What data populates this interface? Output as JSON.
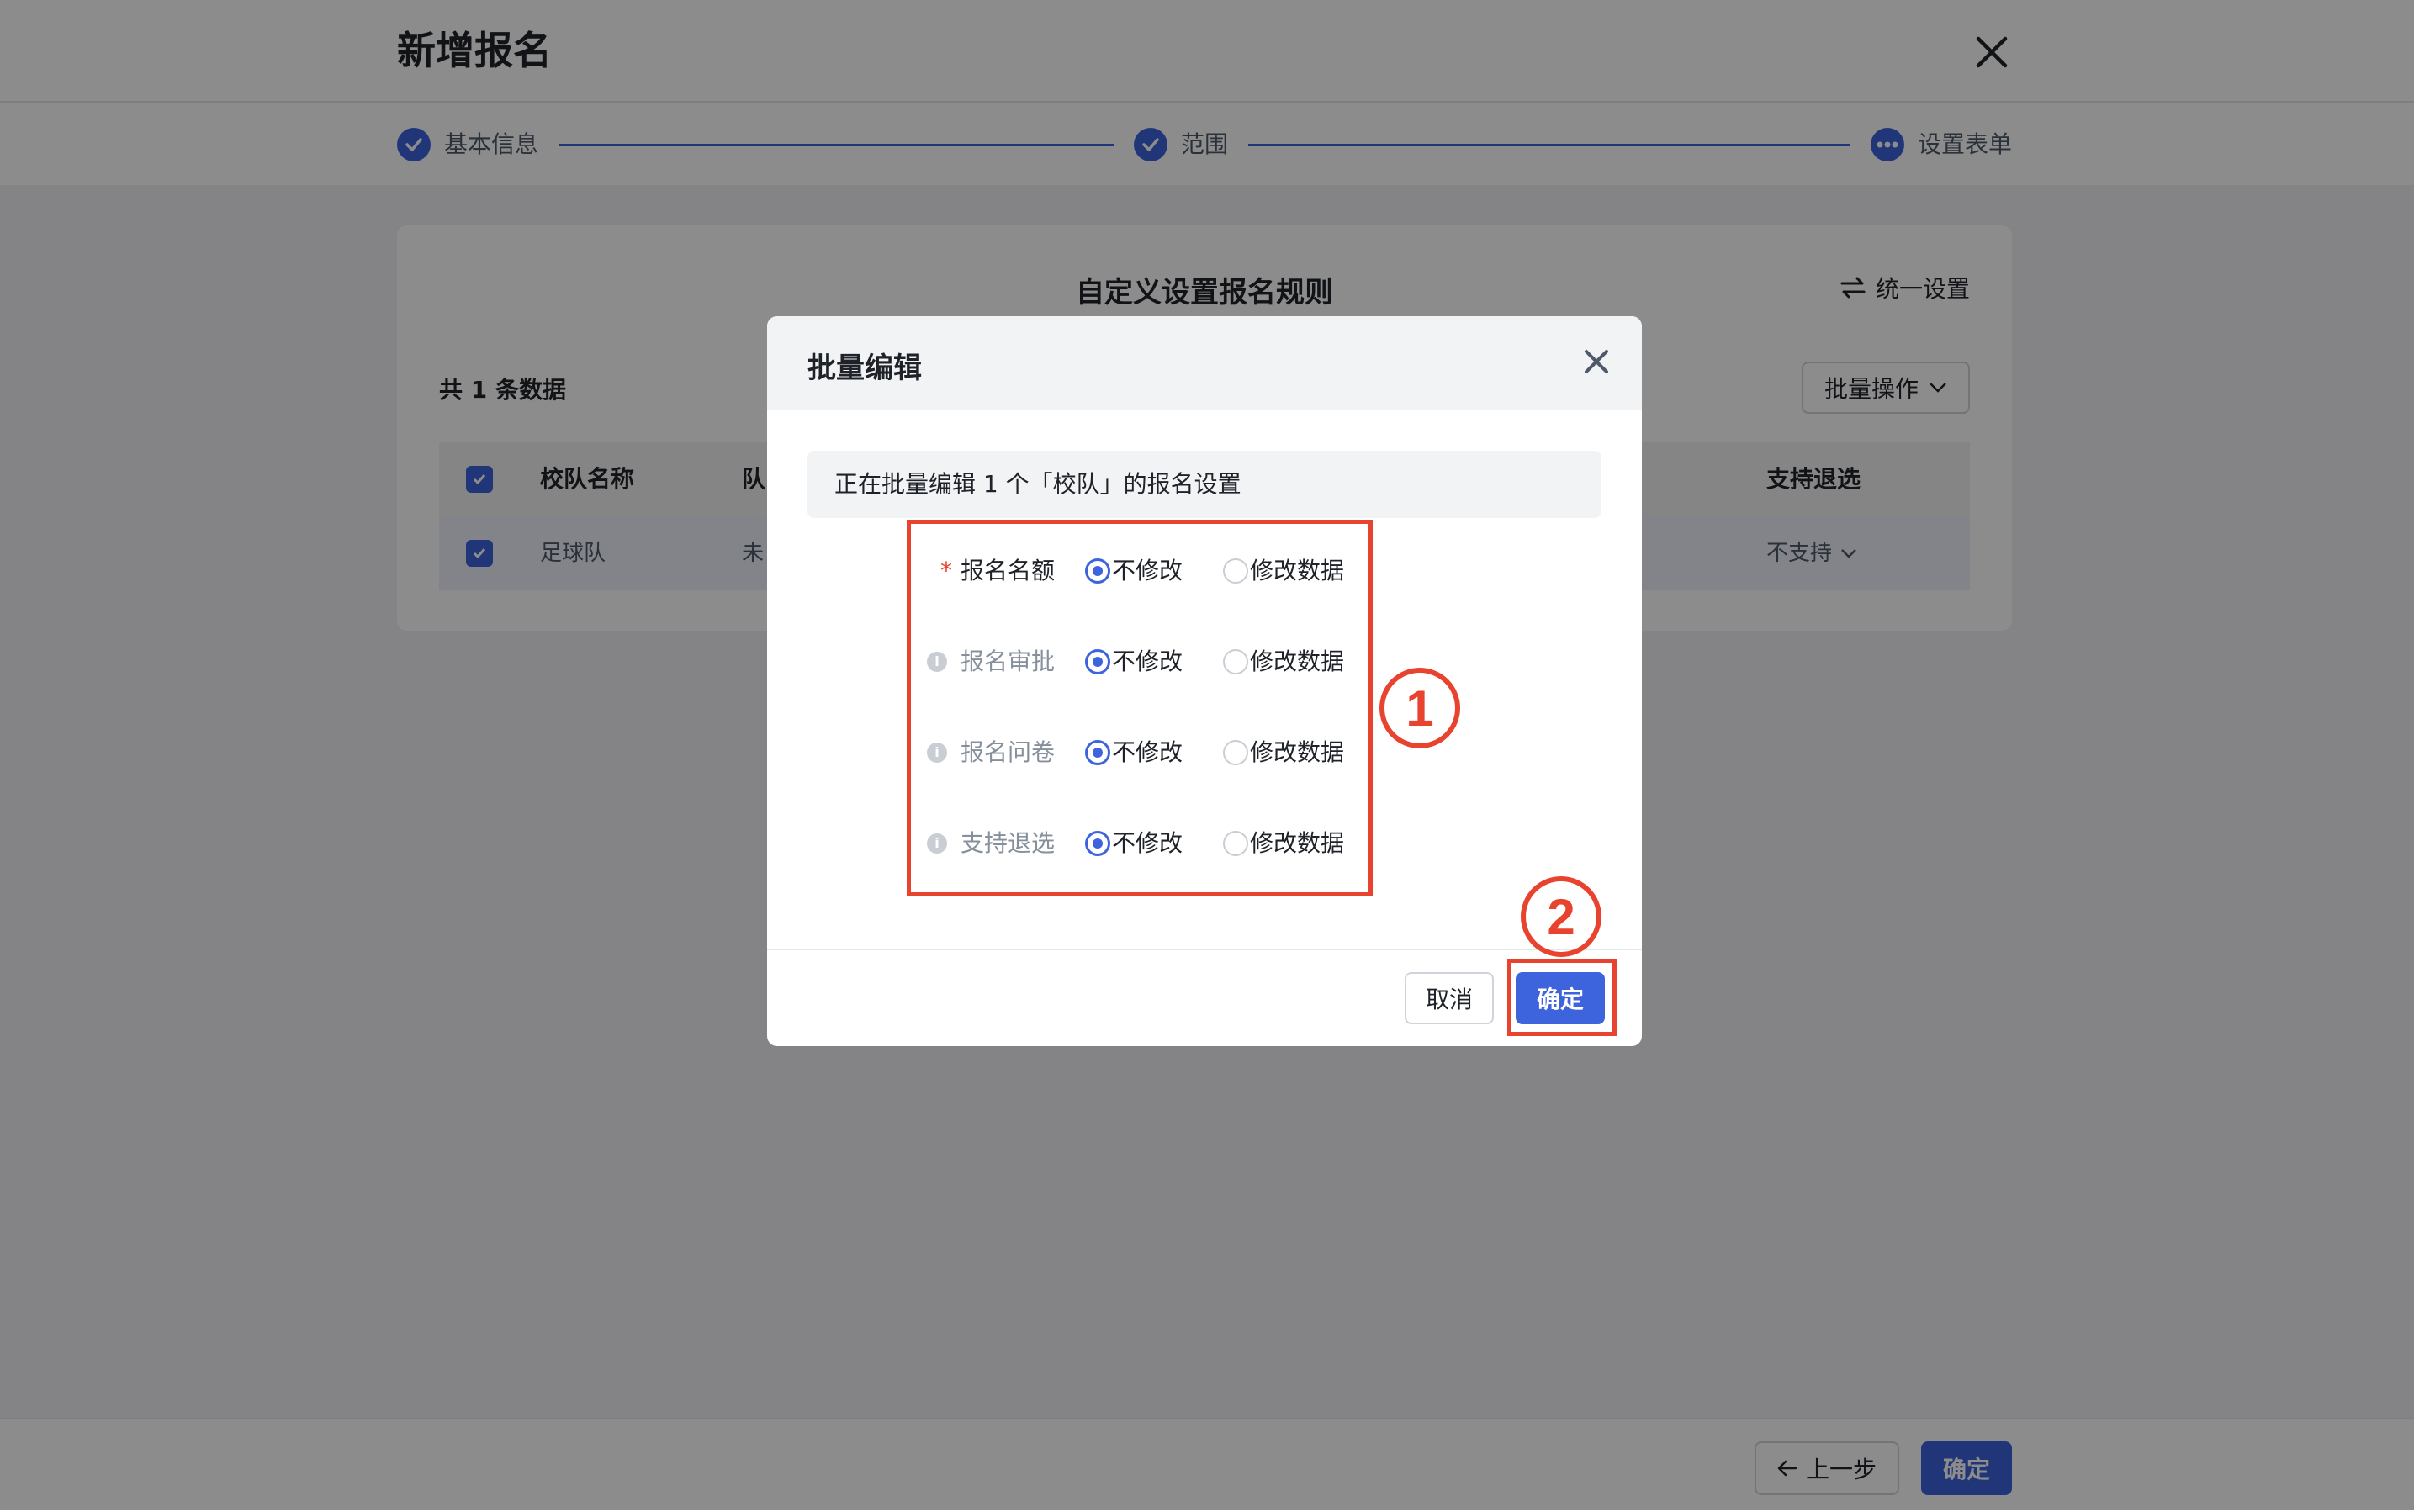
{
  "header": {
    "title": "新增报名"
  },
  "steps": [
    {
      "label": "基本信息",
      "state": "done"
    },
    {
      "label": "范围",
      "state": "done"
    },
    {
      "label": "设置表单",
      "state": "current"
    }
  ],
  "card": {
    "title": "自定义设置报名规则",
    "unify_label": "统一设置",
    "count_text": "共 1 条数据",
    "bulk_label": "批量操作",
    "table": {
      "headers": [
        "校队名称",
        "队",
        "支持退选"
      ],
      "rows": [
        {
          "name": "足球队",
          "col2": "未",
          "refund": "不支持"
        }
      ]
    }
  },
  "footer": {
    "prev_label": "上一步",
    "ok_label": "确定"
  },
  "modal": {
    "title": "批量编辑",
    "notice": "正在批量编辑 1 个「校队」的报名设置",
    "required_mark": "*",
    "info_glyph": "i",
    "fields": [
      {
        "label": "报名名额",
        "required": true,
        "opt1": "不修改",
        "opt2": "修改数据",
        "selected": 1
      },
      {
        "label": "报名审批",
        "required": false,
        "opt1": "不修改",
        "opt2": "修改数据",
        "selected": 1
      },
      {
        "label": "报名问卷",
        "required": false,
        "opt1": "不修改",
        "opt2": "修改数据",
        "selected": 1
      },
      {
        "label": "支持退选",
        "required": false,
        "opt1": "不修改",
        "opt2": "修改数据",
        "selected": 1
      }
    ],
    "cancel_label": "取消",
    "confirm_label": "确定"
  },
  "annotations": {
    "marker1": "1",
    "marker2": "2"
  },
  "colors": {
    "accent": "#3d63dd",
    "annotation": "#e8432e",
    "required": "#e8432e"
  }
}
